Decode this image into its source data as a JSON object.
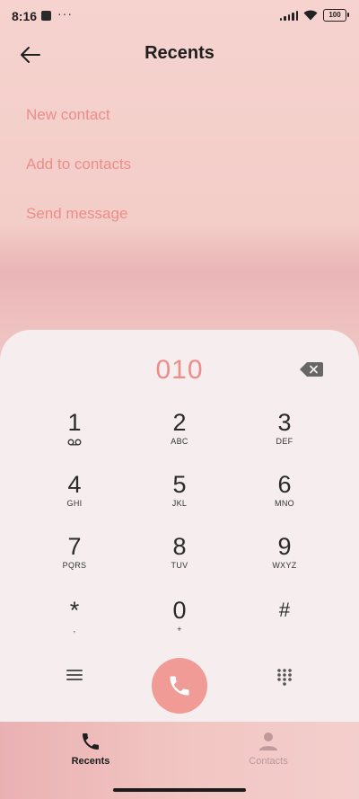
{
  "status": {
    "time": "8:16",
    "dots": "···",
    "battery": "100"
  },
  "header": {
    "title": "Recents"
  },
  "actions": [
    "New contact",
    "Add to contacts",
    "Send message"
  ],
  "dialer": {
    "number": "010",
    "keys": [
      {
        "digit": "1",
        "letters": ""
      },
      {
        "digit": "2",
        "letters": "ABC"
      },
      {
        "digit": "3",
        "letters": "DEF"
      },
      {
        "digit": "4",
        "letters": "GHI"
      },
      {
        "digit": "5",
        "letters": "JKL"
      },
      {
        "digit": "6",
        "letters": "MNO"
      },
      {
        "digit": "7",
        "letters": "PQRS"
      },
      {
        "digit": "8",
        "letters": "TUV"
      },
      {
        "digit": "9",
        "letters": "WXYZ"
      },
      {
        "digit": "*",
        "letters": ","
      },
      {
        "digit": "0",
        "letters": "+"
      },
      {
        "digit": "#",
        "letters": ""
      }
    ]
  },
  "nav": {
    "recents": "Recents",
    "contacts": "Contacts"
  },
  "colors": {
    "accent": "#ec8d8a",
    "call": "#f19b97",
    "pad": "#f6eeee"
  }
}
